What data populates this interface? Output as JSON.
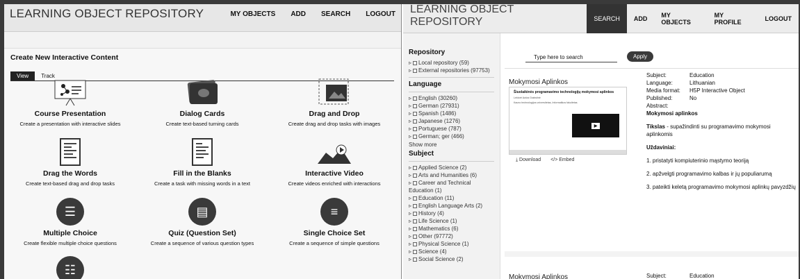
{
  "left": {
    "title": "LEARNING OBJECT REPOSITORY",
    "nav": [
      "MY OBJECTS",
      "ADD",
      "SEARCH",
      "LOGOUT"
    ],
    "heading": "Create New Interactive Content",
    "tabs": [
      "View",
      "Track"
    ],
    "content_types": [
      {
        "name": "Course Presentation",
        "desc": "Create a presentation with interactive slides",
        "icon": "presentation-icon"
      },
      {
        "name": "Dialog Cards",
        "desc": "Create text-based turning cards",
        "icon": "cards-icon"
      },
      {
        "name": "Drag and Drop",
        "desc": "Create drag and drop tasks with images",
        "icon": "drag-drop-icon"
      },
      {
        "name": "Drag the Words",
        "desc": "Create text-based drag and drop tasks",
        "icon": "document-icon"
      },
      {
        "name": "Fill in the Blanks",
        "desc": "Create a task with missing words in a text",
        "icon": "document-icon"
      },
      {
        "name": "Interactive Video",
        "desc": "Create videos enriched with interactions",
        "icon": "video-icon"
      },
      {
        "name": "Multiple Choice",
        "desc": "Create flexible multiple choice questions",
        "icon": "list-circle-icon"
      },
      {
        "name": "Quiz (Question Set)",
        "desc": "Create a sequence of various question types",
        "icon": "quiz-circle-icon"
      },
      {
        "name": "Single Choice Set",
        "desc": "Create a sequence of simple questions",
        "icon": "single-choice-icon"
      }
    ]
  },
  "right": {
    "title": "LEARNING OBJECT REPOSITORY",
    "nav": [
      "SEARCH",
      "ADD",
      "MY OBJECTS",
      "MY PROFILE",
      "LOGOUT"
    ],
    "sidebar": {
      "repository_heading": "Repository",
      "repository": [
        "Local repository (59)",
        "External repositories (97753)"
      ],
      "language_heading": "Language",
      "languages": [
        "English (30260)",
        "German (27931)",
        "Spanish (1486)",
        "Japanese (1276)",
        "Portuguese (787)",
        "German; ger (466)"
      ],
      "show_more": "Show more",
      "subject_heading": "Subject",
      "subjects": [
        "Applied Science (2)",
        "Arts and Humanities (6)",
        "Career and Technical",
        "Education (1)",
        "Education (11)",
        "English Language Arts (2)",
        "History (4)",
        "Life Science (1)",
        "Mathematics (6)",
        "Other (97772)",
        "Physical Science (1)",
        "Science (4)",
        "Social Science (2)"
      ]
    },
    "search": {
      "placeholder": "Type here to search",
      "apply": "Apply"
    },
    "result": {
      "title": "Mokymosi Aplinkos",
      "preview_title": "Šiuolaikinės programavimo technologijų mokymosi aplinkos",
      "preview_sub": "Lektorė Aušra Grabstinė",
      "preview_sub2": "Kauno technologijos universitetas, Informatikos fakultetas",
      "download": "Download",
      "embed": "Embed",
      "meta": [
        {
          "k": "Subject:",
          "v": "Education"
        },
        {
          "k": "Language:",
          "v": "Lithuanian"
        },
        {
          "k": "Media format:",
          "v": "H5P Interactive Object"
        },
        {
          "k": "Published:",
          "v": "No"
        },
        {
          "k": "Abstract:",
          "v": ""
        }
      ],
      "abstract_title": "Mokymosi aplinkos",
      "tikslas_label": "Tikslas",
      "tikslas": " - supažindinti su programavimo mokymosi aplinkomis",
      "uzdaviniai": "Uždaviniai:",
      "steps": [
        "1. pristatyti kompiuterinio mąstymo teoriją",
        "2. apžvelgti programavimo kalbas ir jų populiarumą",
        "3. pateikti keletą programavimo mokymosi aplinkų pavyzdžių"
      ]
    },
    "result2": {
      "title": "Mokymosi Aplinkos",
      "subject_k": "Subject:",
      "subject_v": "Education"
    }
  }
}
